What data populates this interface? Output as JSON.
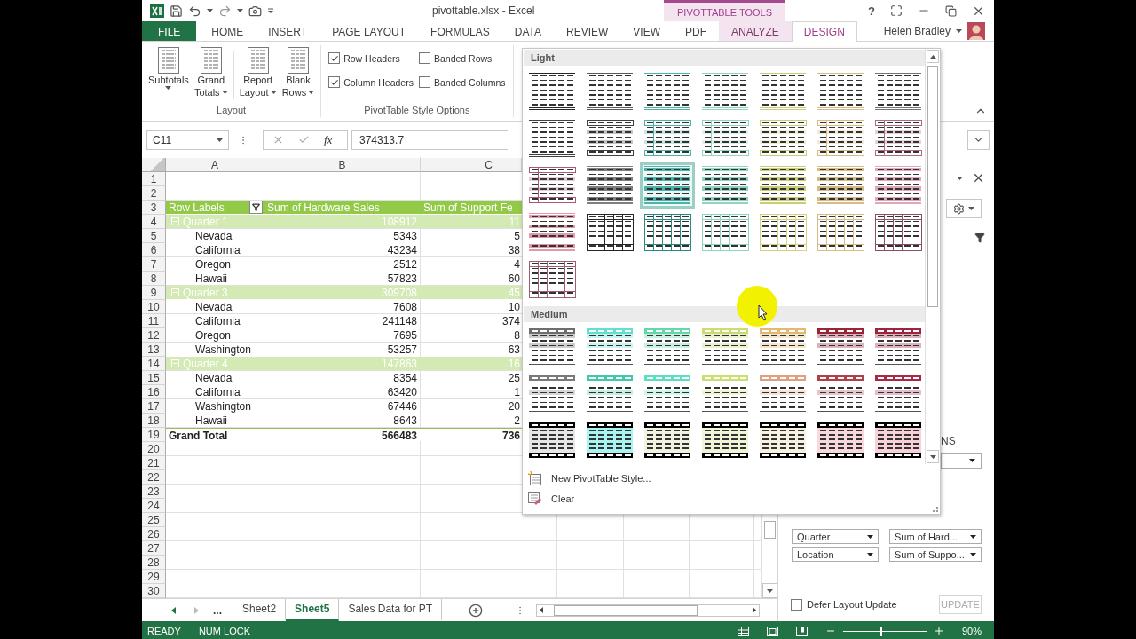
{
  "title_bar": {
    "title": "pivottable.xlsx - Excel",
    "context_label": "PIVOTTABLE TOOLS",
    "help": "?"
  },
  "ribbon_tabs": [
    {
      "label": "FILE",
      "kind": "file",
      "selected": false
    },
    {
      "label": "HOME",
      "kind": "normal",
      "selected": false
    },
    {
      "label": "INSERT",
      "kind": "normal",
      "selected": false
    },
    {
      "label": "PAGE LAYOUT",
      "kind": "normal",
      "selected": false
    },
    {
      "label": "FORMULAS",
      "kind": "normal",
      "selected": false
    },
    {
      "label": "DATA",
      "kind": "normal",
      "selected": false
    },
    {
      "label": "REVIEW",
      "kind": "normal",
      "selected": false
    },
    {
      "label": "VIEW",
      "kind": "normal",
      "selected": false
    },
    {
      "label": "PDF",
      "kind": "normal",
      "selected": false
    },
    {
      "label": "ANALYZE",
      "kind": "context",
      "selected": false
    },
    {
      "label": "DESIGN",
      "kind": "context",
      "selected": true
    }
  ],
  "user": {
    "name": "Helen Bradley"
  },
  "ribbon_groups": [
    {
      "label": "Layout",
      "kind": "buttons",
      "buttons": [
        {
          "lines": [
            "Subtotals"
          ]
        },
        {
          "lines": [
            "Grand",
            "Totals"
          ]
        },
        {
          "lines": [
            "Report",
            "Layout"
          ]
        },
        {
          "lines": [
            "Blank",
            "Rows"
          ]
        }
      ]
    },
    {
      "label": "PivotTable Style Options",
      "kind": "checks",
      "options": [
        {
          "label": "Row Headers",
          "checked": true
        },
        {
          "label": "Banded Rows",
          "checked": false
        },
        {
          "label": "Column Headers",
          "checked": true
        },
        {
          "label": "Banded Columns",
          "checked": false
        }
      ]
    }
  ],
  "formula_bar": {
    "name_box": "C11",
    "fx": "fx",
    "value": "374313.7"
  },
  "sheet": {
    "columns": [
      "A",
      "B",
      "C"
    ],
    "rows": [
      {
        "number": "1",
        "kind": "empty"
      },
      {
        "number": "2",
        "kind": "empty"
      },
      {
        "number": "3",
        "kind": "header",
        "cells": [
          "Row Labels",
          "Sum of Hardware Sales",
          "Sum of Support Fe"
        ]
      },
      {
        "number": "4",
        "kind": "group",
        "expanded": true,
        "cells": [
          "Quarter 1",
          "108912",
          "11"
        ]
      },
      {
        "number": "5",
        "kind": "item",
        "cells": [
          "Nevada",
          "5343",
          "5"
        ]
      },
      {
        "number": "6",
        "kind": "item",
        "cells": [
          "California",
          "43234",
          "38"
        ]
      },
      {
        "number": "7",
        "kind": "item",
        "cells": [
          "Oregon",
          "2512",
          "4"
        ]
      },
      {
        "number": "8",
        "kind": "item",
        "cells": [
          "Hawaii",
          "57823",
          "60"
        ]
      },
      {
        "number": "9",
        "kind": "group",
        "expanded": true,
        "cells": [
          "Quarter 3",
          "309708",
          "45"
        ]
      },
      {
        "number": "10",
        "kind": "item",
        "cells": [
          "Nevada",
          "7608",
          "10"
        ]
      },
      {
        "number": "11",
        "kind": "item",
        "cells": [
          "California",
          "241148",
          "374"
        ]
      },
      {
        "number": "12",
        "kind": "item",
        "cells": [
          "Oregon",
          "7695",
          "8"
        ]
      },
      {
        "number": "13",
        "kind": "item",
        "cells": [
          "Washington",
          "53257",
          "63"
        ]
      },
      {
        "number": "14",
        "kind": "group",
        "expanded": true,
        "cells": [
          "Quarter 4",
          "147863",
          "16"
        ]
      },
      {
        "number": "15",
        "kind": "item",
        "cells": [
          "Nevada",
          "8354",
          "25"
        ]
      },
      {
        "number": "16",
        "kind": "item",
        "cells": [
          "California",
          "63420",
          "1"
        ]
      },
      {
        "number": "17",
        "kind": "item",
        "cells": [
          "Washington",
          "67446",
          "20"
        ]
      },
      {
        "number": "18",
        "kind": "item",
        "cells": [
          "Hawaii",
          "8643",
          "2"
        ]
      },
      {
        "number": "19",
        "kind": "total",
        "cells": [
          "Grand Total",
          "566483",
          "736"
        ]
      },
      {
        "number": "20",
        "kind": "empty"
      },
      {
        "number": "21",
        "kind": "empty"
      },
      {
        "number": "22",
        "kind": "empty"
      },
      {
        "number": "23",
        "kind": "empty"
      },
      {
        "number": "24",
        "kind": "empty"
      },
      {
        "number": "25",
        "kind": "empty"
      },
      {
        "number": "26",
        "kind": "empty"
      },
      {
        "number": "27",
        "kind": "empty"
      },
      {
        "number": "28",
        "kind": "empty"
      },
      {
        "number": "29",
        "kind": "empty"
      },
      {
        "number": "30",
        "kind": "empty"
      }
    ]
  },
  "sheet_tabs": {
    "overflow": "...",
    "items": [
      {
        "label": "Sheet2",
        "selected": false
      },
      {
        "label": "Sheet5",
        "selected": true
      },
      {
        "label": "Sales Data for PT",
        "selected": false
      }
    ]
  },
  "fields_pane": {
    "columns_label": "NS",
    "rows_fields": [
      "Quarter",
      "Location"
    ],
    "values_fields": [
      "Sum of Hard...",
      "Sum of Suppo..."
    ],
    "defer": {
      "label": "Defer Layout Update",
      "checked": false
    },
    "update_button": {
      "label": "UPDATE",
      "disabled": true
    }
  },
  "style_gallery": {
    "sections": [
      {
        "title": "Light",
        "styles": [
          {
            "kind": "lines",
            "color": "#262626",
            "selected": false
          },
          {
            "kind": "lines",
            "color": "#595959",
            "selected": false
          },
          {
            "kind": "lines",
            "color": "#4bb3aa",
            "selected": false
          },
          {
            "kind": "lines",
            "color": "#8ed4c0",
            "selected": false
          },
          {
            "kind": "lines",
            "color": "#c9ce76",
            "selected": false
          },
          {
            "kind": "lines",
            "color": "#d6bb85",
            "selected": false
          },
          {
            "kind": "lines",
            "color": "#737373",
            "selected": false
          },
          {
            "kind": "lines",
            "color": "#404040",
            "selected": false
          },
          {
            "kind": "framed",
            "color": "#404040",
            "selected": false
          },
          {
            "kind": "framed",
            "color": "#4bb3aa",
            "selected": false
          },
          {
            "kind": "framed",
            "color": "#8ed4c0",
            "selected": false
          },
          {
            "kind": "framed",
            "color": "#c9ce76",
            "selected": false
          },
          {
            "kind": "framed",
            "color": "#d6bb85",
            "selected": false
          },
          {
            "kind": "framed",
            "color": "#b06a80",
            "selected": false
          },
          {
            "kind": "framed",
            "color": "#a85a70",
            "selected": false
          },
          {
            "kind": "banded",
            "color": "#808080",
            "selected": false
          },
          {
            "kind": "banded",
            "color": "#4bb3aa",
            "selected": true
          },
          {
            "kind": "banded",
            "color": "#8ed4c0",
            "selected": false
          },
          {
            "kind": "banded",
            "color": "#c9ce76",
            "selected": false
          },
          {
            "kind": "banded",
            "color": "#d6bb85",
            "selected": false
          },
          {
            "kind": "banded",
            "color": "#e2a8b8",
            "selected": false
          },
          {
            "kind": "banded",
            "color": "#e09aac",
            "selected": false
          },
          {
            "kind": "grid",
            "color": "#262626",
            "selected": false
          },
          {
            "kind": "grid",
            "color": "#2a8a80",
            "selected": false
          },
          {
            "kind": "grid",
            "color": "#8ed4c0",
            "selected": false
          },
          {
            "kind": "grid",
            "color": "#d6d27e",
            "selected": false
          },
          {
            "kind": "grid",
            "color": "#d6bb85",
            "selected": false
          },
          {
            "kind": "grid",
            "color": "#8a5060",
            "selected": false
          },
          {
            "kind": "grid",
            "color": "#9a6070",
            "selected": false
          }
        ]
      },
      {
        "title": "Medium",
        "styles": [
          {
            "kind": "header",
            "color": "#6e6e6e",
            "selected": false
          },
          {
            "kind": "header",
            "color": "#5fe0d0",
            "selected": false
          },
          {
            "kind": "header",
            "color": "#62d8a8",
            "selected": false
          },
          {
            "kind": "header",
            "color": "#c9dc6e",
            "selected": false
          },
          {
            "kind": "header",
            "color": "#e4b870",
            "selected": false
          },
          {
            "kind": "header",
            "color": "#9e2235",
            "selected": false
          },
          {
            "kind": "header",
            "color": "#a0223e",
            "selected": false
          },
          {
            "kind": "headerlight",
            "color": "#7a7a7a",
            "selected": false
          },
          {
            "kind": "headerlight",
            "color": "#3ec9a8",
            "selected": false
          },
          {
            "kind": "headerlight",
            "color": "#5ae0c0",
            "selected": false
          },
          {
            "kind": "headerlight",
            "color": "#c8e070",
            "selected": false
          },
          {
            "kind": "headerlight",
            "color": "#e0a080",
            "selected": false
          },
          {
            "kind": "headerlight",
            "color": "#b04048",
            "selected": false
          },
          {
            "kind": "headerlight",
            "color": "#a82848",
            "selected": false
          },
          {
            "kind": "dark",
            "color": "#e6e6e6",
            "selected": false
          },
          {
            "kind": "dark",
            "color": "#a8f4f0",
            "selected": false
          },
          {
            "kind": "dark",
            "color": "#f2f2e0",
            "selected": false
          },
          {
            "kind": "dark",
            "color": "#f2f4d8",
            "selected": false
          },
          {
            "kind": "dark",
            "color": "#f8f0e0",
            "selected": false
          },
          {
            "kind": "dark",
            "color": "#f8d8dc",
            "selected": false
          },
          {
            "kind": "dark",
            "color": "#f8d0d8",
            "selected": false
          }
        ]
      }
    ],
    "commands": [
      {
        "label": "New PivotTable Style...",
        "kind": "new"
      },
      {
        "label": "Clear",
        "kind": "clear"
      }
    ]
  },
  "status_bar": {
    "items": [
      "READY",
      "NUM LOCK"
    ],
    "zoom": {
      "level": 0.45,
      "reading": "90%"
    }
  }
}
